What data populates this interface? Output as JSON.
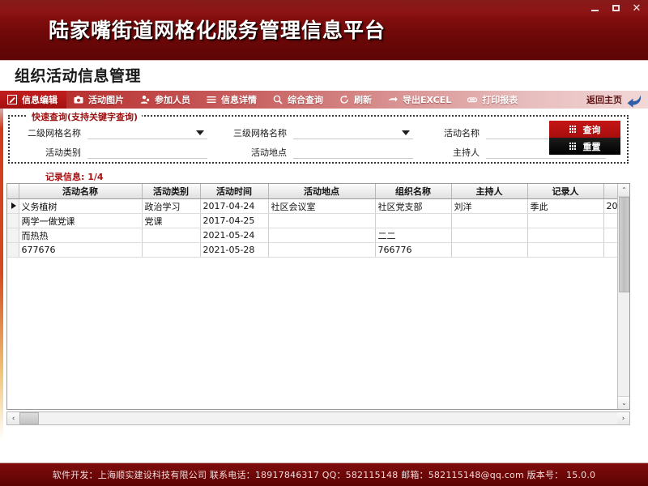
{
  "window": {
    "app_title": "陆家嘴街道网格化服务管理信息平台",
    "minimize_label": "–",
    "maximize_label": "□",
    "close_label": "✕"
  },
  "page": {
    "title": "组织活动信息管理"
  },
  "toolbar": {
    "items": [
      {
        "label": "信息编辑",
        "icon": "edit-icon",
        "active": true
      },
      {
        "label": "活动图片",
        "icon": "camera-icon",
        "active": false
      },
      {
        "label": "参加人员",
        "icon": "person-icon",
        "active": false
      },
      {
        "label": "信息详情",
        "icon": "list-icon",
        "active": false
      },
      {
        "label": "综合查询",
        "icon": "search-icon",
        "active": false
      },
      {
        "label": "刷新",
        "icon": "refresh-icon",
        "active": false
      },
      {
        "label": "导出EXCEL",
        "icon": "export-icon",
        "active": false
      },
      {
        "label": "打印报表",
        "icon": "print-icon",
        "active": false
      }
    ],
    "home_label": "返回主页",
    "home_icon": "back-arrow-icon"
  },
  "query": {
    "legend": "快速查询(支持关键字查询)",
    "fields": [
      {
        "label": "二级网格名称",
        "value": "",
        "type": "select"
      },
      {
        "label": "三级网格名称",
        "value": "",
        "type": "select"
      },
      {
        "label": "活动名称",
        "value": "",
        "type": "text"
      },
      {
        "label": "活动类别",
        "value": "",
        "type": "text"
      },
      {
        "label": "活动地点",
        "value": "",
        "type": "text"
      },
      {
        "label": "主持人",
        "value": "",
        "type": "text"
      }
    ],
    "search_button": "查询",
    "reset_button": "重置"
  },
  "record_info": "记录信息: 1/4",
  "table": {
    "columns": [
      "活动名称",
      "活动类别",
      "活动时间",
      "活动地点",
      "组织名称",
      "主持人",
      "记录人",
      ""
    ],
    "rows": [
      {
        "selected": true,
        "cells": [
          "义务植树",
          "政治学习",
          "2017-04-24",
          "社区会议室",
          "社区党支部",
          "刘洋",
          "季此",
          "20"
        ]
      },
      {
        "selected": false,
        "cells": [
          "两学一做党课",
          "党课",
          "2017-04-25",
          "",
          "",
          "",
          "",
          ""
        ]
      },
      {
        "selected": false,
        "cells": [
          "而热热",
          "",
          "2021-05-24",
          "",
          "二二",
          "",
          "",
          ""
        ]
      },
      {
        "selected": false,
        "cells": [
          "677676",
          "",
          "2021-05-28",
          "",
          "766776",
          "",
          "",
          ""
        ]
      }
    ],
    "scroll_up": "⌃",
    "scroll_down": "⌄",
    "scroll_left": "‹",
    "scroll_right": "›"
  },
  "footer": {
    "text": "软件开发：上海顺实建设科技有限公司    联系电话：18917846317  QQ：582115148 邮箱：582115148@qq.com    版本号： 15.0.0"
  },
  "colors": {
    "brand_dark_red": "#7e0c0c",
    "accent_red": "#c51616",
    "reset_black": "#000000",
    "record_red": "#a91212"
  }
}
